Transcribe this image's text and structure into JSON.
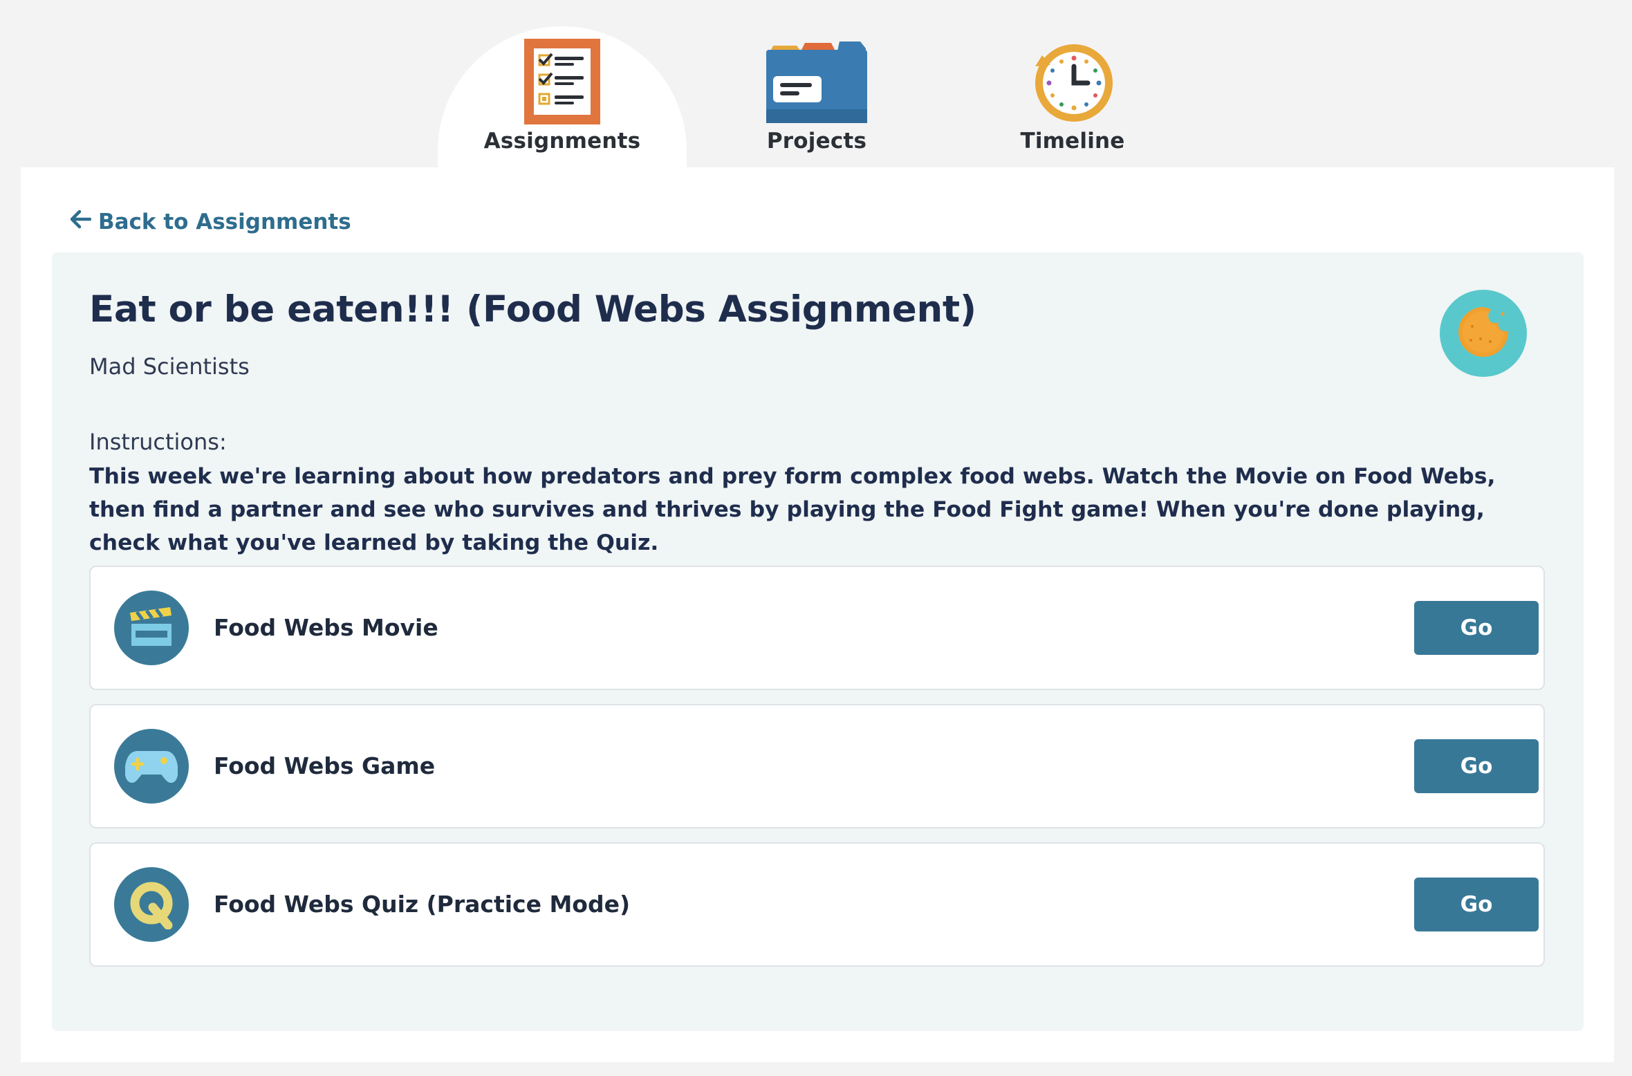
{
  "tabs": [
    {
      "label": "Assignments",
      "icon": "checklist-icon",
      "active": true
    },
    {
      "label": "Projects",
      "icon": "folder-icon",
      "active": false
    },
    {
      "label": "Timeline",
      "icon": "clock-icon",
      "active": false
    }
  ],
  "back_link": {
    "label": "Back to Assignments",
    "icon": "arrow-left-icon"
  },
  "assignment": {
    "title": "Eat or be eaten!!! (Food Webs Assignment)",
    "class_name": "Mad Scientists",
    "avatar_icon": "cookie-icon",
    "instructions_label": "Instructions:",
    "instructions_text": "This week we're learning about how predators and prey form complex food webs. Watch the Movie on Food Webs, then find a partner and see who survives and thrives by playing the Food Fight game! When you're done playing, check what you've learned by taking the Quiz."
  },
  "activities": [
    {
      "label": "Food Webs Movie",
      "icon": "clapperboard-icon",
      "button": "Go"
    },
    {
      "label": "Food Webs Game",
      "icon": "gamepad-icon",
      "button": "Go"
    },
    {
      "label": "Food Webs Quiz (Practice Mode)",
      "icon": "quiz-q-icon",
      "button": "Go"
    }
  ],
  "colors": {
    "accent": "#387897",
    "link": "#2e6d8e",
    "panel_bg": "#f0f5f5",
    "page_bg": "#f3f3f3",
    "avatar_bg": "#58c8cc",
    "title_text": "#1f2d4d"
  }
}
